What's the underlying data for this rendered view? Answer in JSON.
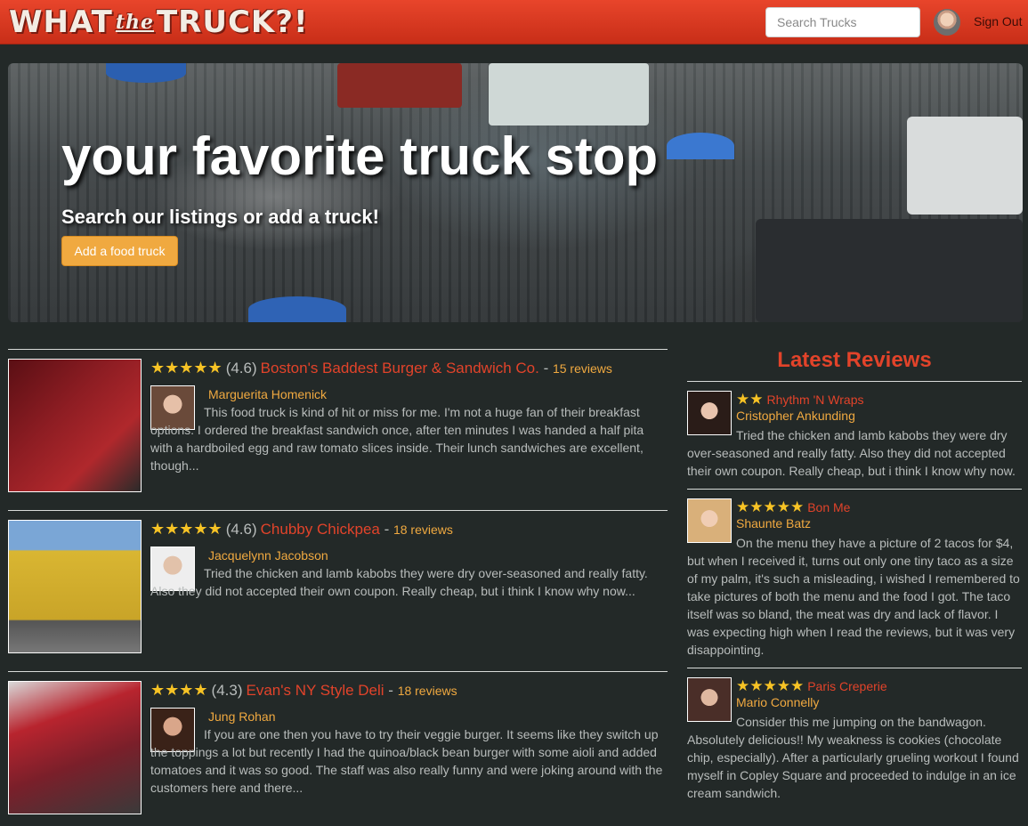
{
  "header": {
    "logo_word1": "WHAT",
    "logo_the": "the",
    "logo_word2": "TRUCK?!",
    "search_placeholder": "Search Trucks",
    "signout_label": "Sign Out"
  },
  "hero": {
    "title": "your favorite truck stop",
    "subtitle": "Search our listings or add a truck!",
    "button_label": "Add a food truck"
  },
  "trucks": [
    {
      "stars": "★★★★★",
      "rating": "(4.6)",
      "name": "Boston's Baddest Burger & Sandwich Co.",
      "separator": " - ",
      "reviews": "15 reviews",
      "reviewer": "Marguerita Homenick",
      "review": "This food truck is kind of hit or miss for me. I'm not a huge fan of their breakfast options. I ordered the breakfast sandwich once, after ten minutes I was handed a half pita with a hardboiled egg and raw tomato slices inside. Their lunch sandwiches are excellent, though...",
      "img_color": "#8e1d23",
      "avatar_color": "#b07a66"
    },
    {
      "stars": "★★★★★",
      "rating": "(4.6)",
      "name": "Chubby Chickpea",
      "separator": " - ",
      "reviews": "18 reviews",
      "reviewer": "Jacquelynn Jacobson",
      "review": "Tried the chicken and lamb kabobs they were dry over-seasoned and really fatty. Also they did not accepted their own coupon. Really cheap, but i think I know why now...",
      "img_color": "#d9b632",
      "avatar_color": "#9a7a6a"
    },
    {
      "stars": "★★★★",
      "rating": "(4.3)",
      "name": "Evan's NY Style Deli",
      "separator": " - ",
      "reviews": "18 reviews",
      "reviewer": "Jung Rohan",
      "review": "If you are one then you have to try their veggie burger. It seems like they switch up the toppings a lot but recently I had the quinoa/black bean burger with some aioli and added tomatoes and it was so good. The staff was also really funny and were joking around with the customers here and there...",
      "img_color": "#7a1f2a",
      "avatar_color": "#6b3f2f"
    }
  ],
  "sidebar": {
    "title": "Latest Reviews",
    "reviews": [
      {
        "stars": "★★",
        "truck": "Rhythm 'N Wraps",
        "reviewer": "Cristopher Ankunding",
        "text": "Tried the chicken and lamb kabobs they were dry over-seasoned and really fatty. Also they did not accepted their own coupon. Really cheap, but i think I know why now.",
        "avatar_color": "#3a2a26"
      },
      {
        "stars": "★★★★★",
        "truck": "Bon Me",
        "reviewer": "Shaunte Batz",
        "text": "On the menu they have a picture of 2 tacos for $4, but when I received it, turns out only one tiny taco as a size of my palm, it's such a misleading, i wished I remembered to take pictures of both the menu and the food I got. The taco itself was so bland, the meat was dry and lack of flavor. I was expecting high when I read the reviews, but it was very disappointing.",
        "avatar_color": "#d9b07a"
      },
      {
        "stars": "★★★★★",
        "truck": "Paris Creperie",
        "reviewer": "Mario Connelly",
        "text": "Consider this me jumping on the bandwagon. Absolutely delicious!! My weakness is cookies (chocolate chip, especially). After a particularly grueling workout I found myself in Copley Square and proceeded to indulge in an ice cream sandwich.",
        "avatar_color": "#5a3a34"
      }
    ]
  }
}
